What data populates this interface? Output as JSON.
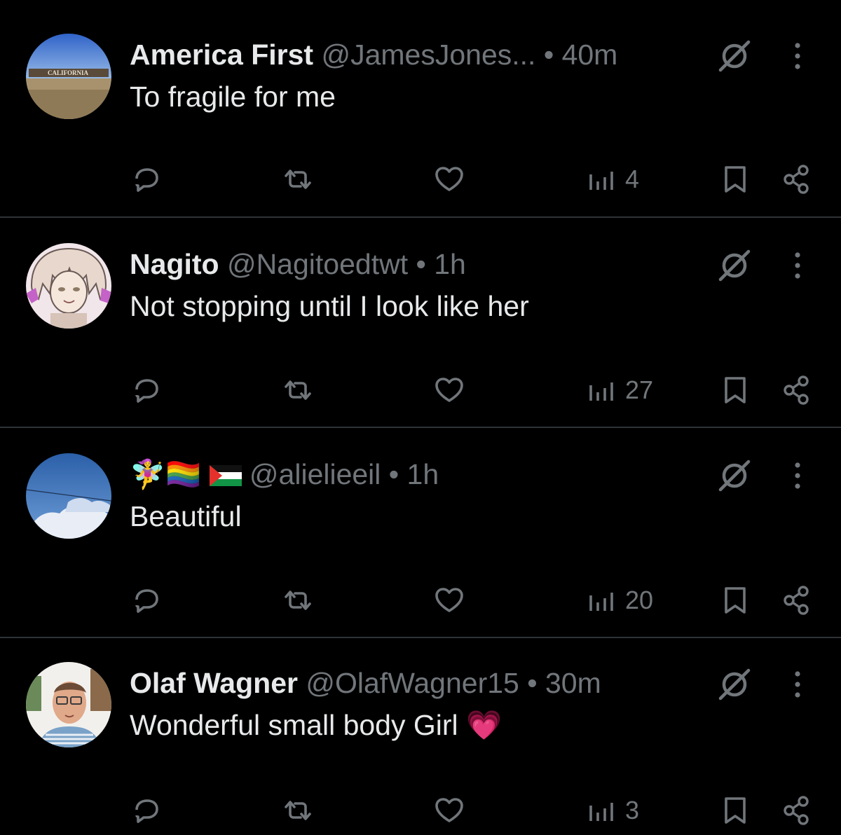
{
  "posts": [
    {
      "name": "America First",
      "handle": "@JamesJones...",
      "dot": " • ",
      "time": "40m",
      "text": "To fragile for me",
      "views": "4",
      "avatar_sign": "CALIFORNIA"
    },
    {
      "name": "Nagito",
      "handle": "@Nagitoedtwt",
      "dot": " • ",
      "time": "1h",
      "text": "Not stopping until I look like her",
      "views": "27"
    },
    {
      "name": "🧚‍♀️🏳️‍🌈",
      "handle": "@alielieeil",
      "dot": " • ",
      "time": "1h",
      "text": "Beautiful",
      "views": "20"
    },
    {
      "name": "Olaf Wagner",
      "handle": "@OlafWagner15",
      "dot": " • ",
      "time": "30m",
      "text": "Wonderful small body Girl",
      "text_emoji": "💗",
      "views": "3"
    }
  ],
  "icons": {
    "reply": "reply-icon",
    "repost": "repost-icon",
    "like": "heart-icon",
    "views": "views-icon",
    "bookmark": "bookmark-icon",
    "share": "share-icon",
    "grok": "grok-icon",
    "more": "more-icon"
  },
  "colors": {
    "background": "#000000",
    "text": "#e7e9ea",
    "muted": "#71767b",
    "divider": "#2f3336"
  }
}
